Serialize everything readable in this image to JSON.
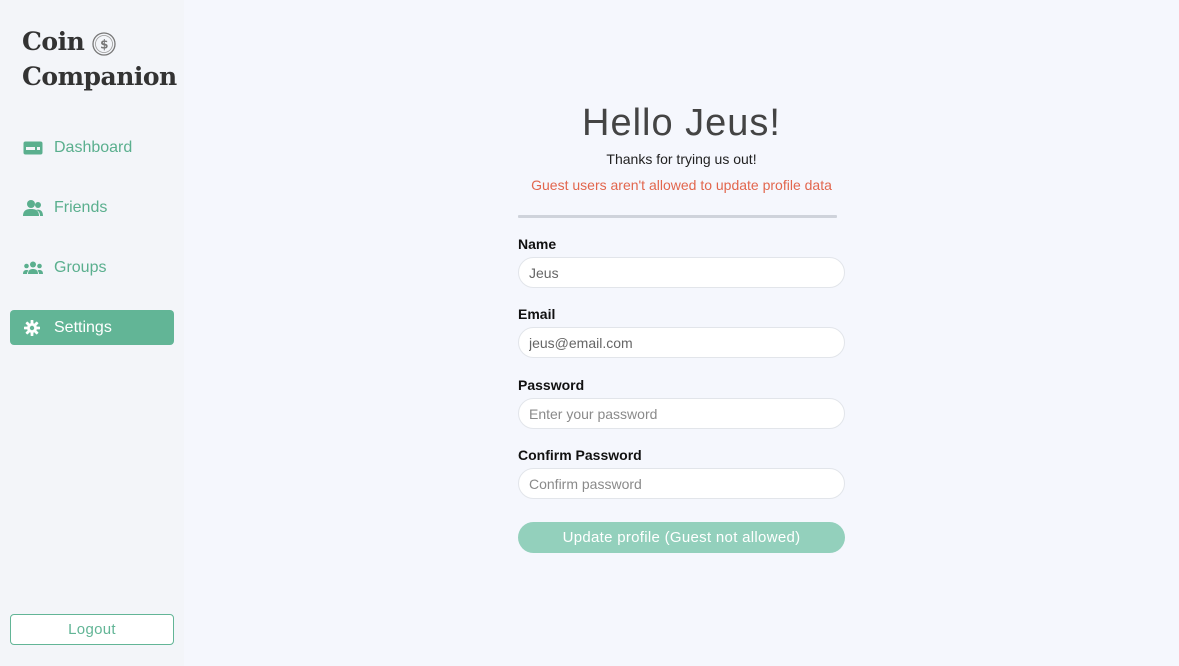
{
  "app": {
    "logo_line1": "Coin",
    "logo_line2": "Companion",
    "logo_icon": "coin-icon"
  },
  "sidebar": {
    "items": [
      {
        "label": "Dashboard",
        "icon": "card-icon",
        "active": false
      },
      {
        "label": "Friends",
        "icon": "person-icon",
        "active": false
      },
      {
        "label": "Groups",
        "icon": "people-icon",
        "active": false
      },
      {
        "label": "Settings",
        "icon": "gear-icon",
        "active": true
      }
    ],
    "logout_label": "Logout"
  },
  "main": {
    "greeting": "Hello Jeus!",
    "subtitle": "Thanks for trying us out!",
    "warning": "Guest users aren't allowed to update profile data",
    "form": {
      "name_label": "Name",
      "name_value": "Jeus",
      "email_label": "Email",
      "email_value": "jeus@email.com",
      "password_label": "Password",
      "password_placeholder": "Enter your password",
      "confirm_label": "Confirm Password",
      "confirm_placeholder": "Confirm password",
      "submit_label": "Update profile (Guest not allowed)"
    }
  },
  "colors": {
    "accent": "#62b596",
    "accent_light": "#93d0bc",
    "warning": "#e2664d",
    "background": "#f5f7fd"
  }
}
